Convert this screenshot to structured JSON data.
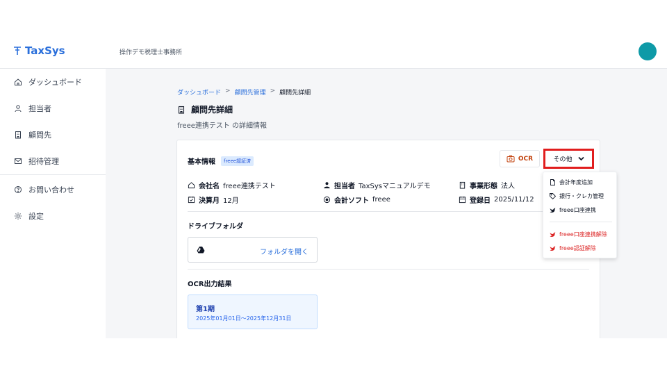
{
  "app": {
    "name": "TaxSys",
    "office": "操作デモ税理士事務所"
  },
  "sidebar": {
    "items": [
      {
        "label": "ダッシュボード",
        "icon": "home-icon"
      },
      {
        "label": "担当者",
        "icon": "person-icon"
      },
      {
        "label": "顧問先",
        "icon": "building-icon"
      },
      {
        "label": "招待管理",
        "icon": "mail-icon"
      },
      {
        "label": "お問い合わせ",
        "icon": "help-icon"
      },
      {
        "label": "設定",
        "icon": "gear-icon"
      }
    ]
  },
  "breadcrumb": {
    "items": [
      "ダッシュボード",
      "顧問先管理",
      "顧問先詳細"
    ],
    "separator": ">"
  },
  "page": {
    "title": "顧問先詳細",
    "subtitle": "freee連携テスト の詳細情報"
  },
  "basic": {
    "heading": "基本情報",
    "badge": "freee認証済",
    "ocr_label": "OCR",
    "other_label": "その他",
    "fields": {
      "company_label": "会社名",
      "company_value": "freee連携テスト",
      "staff_label": "担当者",
      "staff_value": "TaxSysマニュアルデモ",
      "type_label": "事業形態",
      "type_value": "法人",
      "fiscal_label": "決算月",
      "fiscal_value": "12月",
      "software_label": "会計ソフト",
      "software_value": "freee",
      "registered_label": "登録日",
      "registered_value": "2025/11/12"
    }
  },
  "drive": {
    "heading": "ドライブフォルダ",
    "open_label": "フォルダを開く"
  },
  "ocr": {
    "heading": "OCR出力結果",
    "period_title": "第1期",
    "period_range": "2025年01月01日〜2025年12月31日"
  },
  "menu": {
    "items": [
      "会計年度追加",
      "銀行・クレカ管理",
      "freee口座連携"
    ],
    "danger_items": [
      "freee口座連携解除",
      "freee認証解除"
    ]
  },
  "colors": {
    "accent": "#2a6fdb",
    "avatar": "#0e9aa7",
    "highlight": "#e11d1d",
    "danger": "#dc2626"
  }
}
